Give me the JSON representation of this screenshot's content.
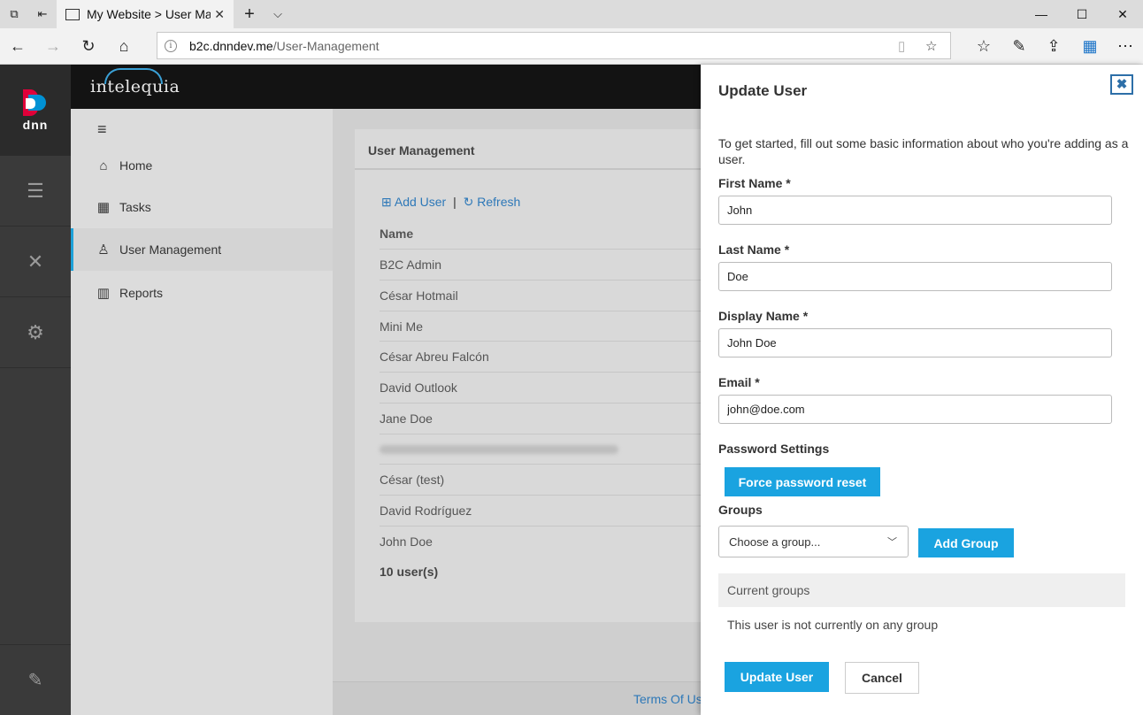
{
  "browser": {
    "tab_title": "My Website > User Mar",
    "new_tab": "+",
    "tab_list": "⌵",
    "url_host": "b2c.dnndev.me",
    "url_path": "/User-Management",
    "win_min": "—",
    "win_max": "☐",
    "win_close": "✕"
  },
  "site": {
    "logo": "intelequia"
  },
  "rail": {
    "brand": "dnn"
  },
  "sidebar": {
    "items": [
      {
        "label": "Home",
        "icon": "home-icon"
      },
      {
        "label": "Tasks",
        "icon": "calendar-icon"
      },
      {
        "label": "User Management",
        "icon": "user-icon"
      },
      {
        "label": "Reports",
        "icon": "chart-icon"
      }
    ]
  },
  "user_panel": {
    "title": "User Management",
    "add_user": "Add User",
    "separator": "|",
    "refresh": "Refresh",
    "column_name": "Name",
    "users": [
      "B2C Admin",
      "César Hotmail",
      "Mini Me",
      "César Abreu Falcón",
      "David Outlook",
      "Jane Doe",
      "",
      "César (test)",
      "David Rodríguez",
      "John Doe"
    ],
    "total": "10 user(s)"
  },
  "footer": {
    "terms": "Terms Of Us"
  },
  "drawer": {
    "title": "Update User",
    "close": "✖",
    "intro": "To get started, fill out some basic information about who you're adding as a user.",
    "first_name_label": "First Name *",
    "first_name_value": "John",
    "last_name_label": "Last Name *",
    "last_name_value": "Doe",
    "display_name_label": "Display Name *",
    "display_name_value": "John Doe",
    "email_label": "Email *",
    "email_value": "john@doe.com",
    "password_label": "Password Settings",
    "force_reset": "Force password reset",
    "groups_label": "Groups",
    "group_select": "Choose a group...",
    "add_group": "Add Group",
    "current_groups": "Current groups",
    "no_groups": "This user is not currently on any group",
    "update_button": "Update User",
    "cancel_button": "Cancel"
  }
}
